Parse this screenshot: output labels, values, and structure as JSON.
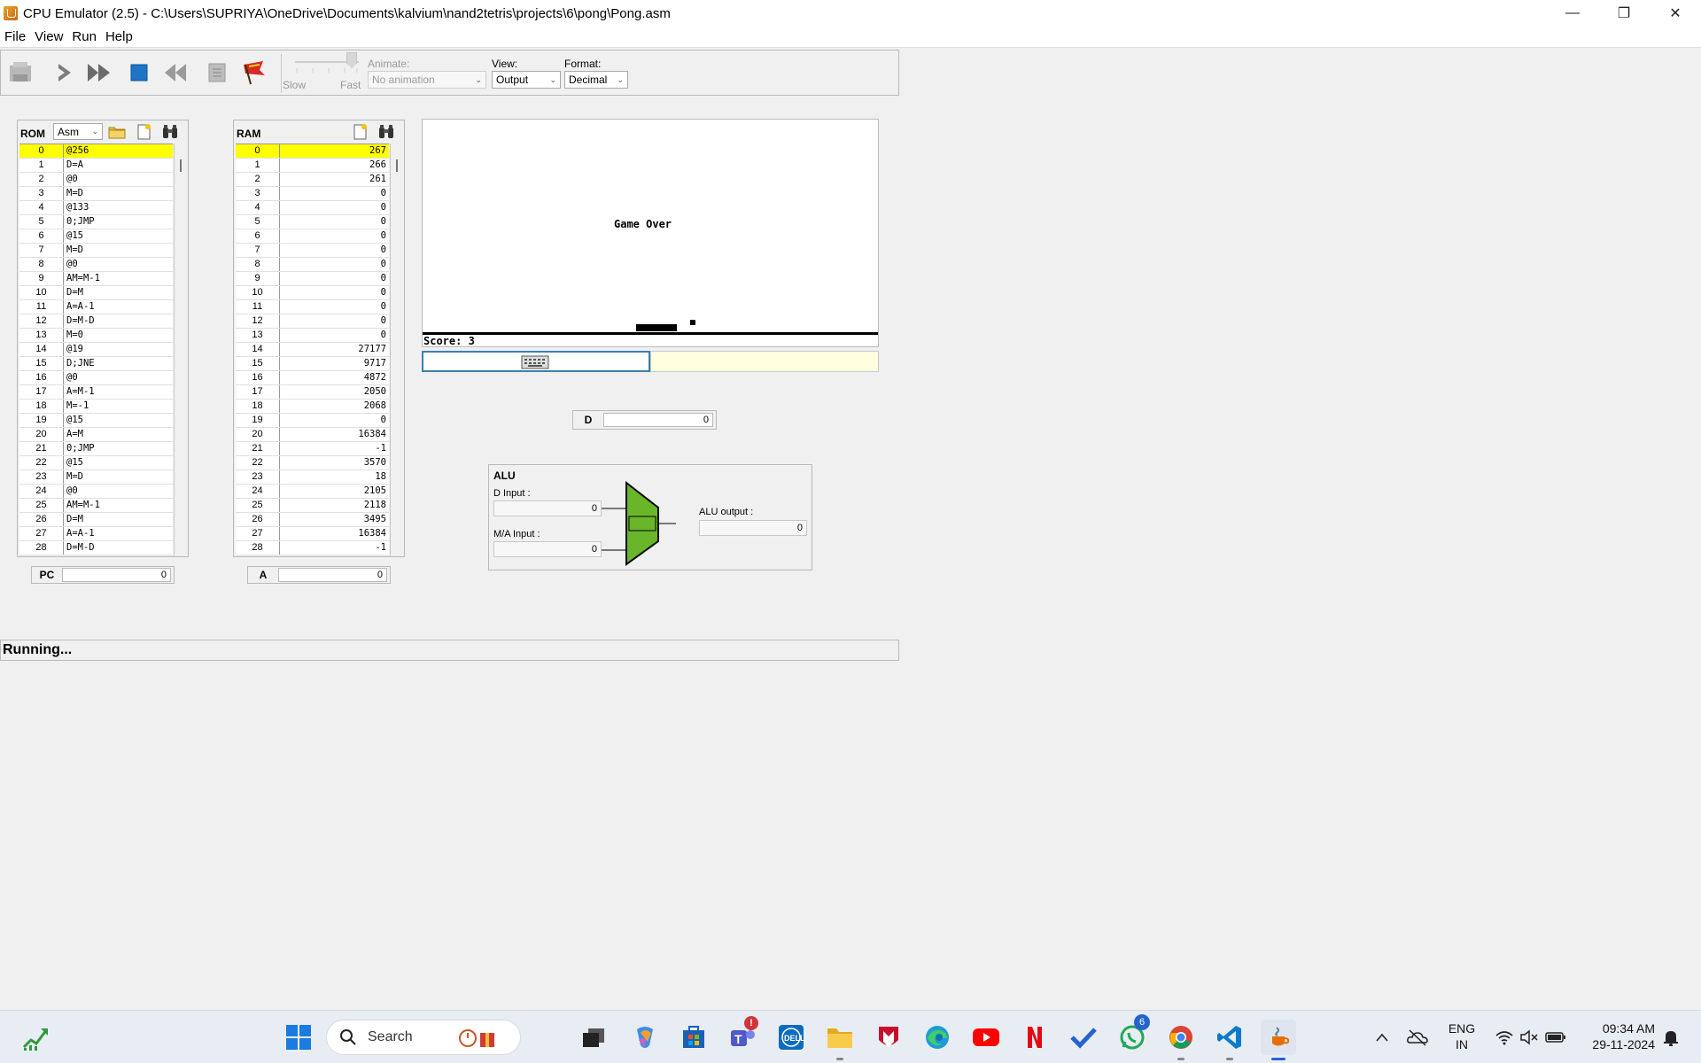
{
  "window": {
    "title": "CPU Emulator (2.5) - C:\\Users\\SUPRIYA\\OneDrive\\Documents\\kalvium\\nand2tetris\\projects\\6\\pong\\Pong.asm",
    "minimize": "—",
    "maximize": "❐",
    "close": "✕"
  },
  "menu": [
    "File",
    "View",
    "Run",
    "Help"
  ],
  "toolbar": {
    "slow_label": "Slow",
    "fast_label": "Fast",
    "animate_label": "Animate:",
    "animate_value": "No animation",
    "view_label": "View:",
    "view_value": "Output",
    "format_label": "Format:",
    "format_value": "Decimal"
  },
  "rom": {
    "title": "ROM",
    "mode": "Asm",
    "rows": [
      [
        "0",
        "@256"
      ],
      [
        "1",
        "D=A"
      ],
      [
        "2",
        "@0"
      ],
      [
        "3",
        "M=D"
      ],
      [
        "4",
        "@133"
      ],
      [
        "5",
        "0;JMP"
      ],
      [
        "6",
        "@15"
      ],
      [
        "7",
        "M=D"
      ],
      [
        "8",
        "@0"
      ],
      [
        "9",
        "AM=M-1"
      ],
      [
        "10",
        "D=M"
      ],
      [
        "11",
        "A=A-1"
      ],
      [
        "12",
        "D=M-D"
      ],
      [
        "13",
        "M=0"
      ],
      [
        "14",
        "@19"
      ],
      [
        "15",
        "D;JNE"
      ],
      [
        "16",
        "@0"
      ],
      [
        "17",
        "A=M-1"
      ],
      [
        "18",
        "M=-1"
      ],
      [
        "19",
        "@15"
      ],
      [
        "20",
        "A=M"
      ],
      [
        "21",
        "0;JMP"
      ],
      [
        "22",
        "@15"
      ],
      [
        "23",
        "M=D"
      ],
      [
        "24",
        "@0"
      ],
      [
        "25",
        "AM=M-1"
      ],
      [
        "26",
        "D=M"
      ],
      [
        "27",
        "A=A-1"
      ],
      [
        "28",
        "D=M-D"
      ]
    ]
  },
  "ram": {
    "title": "RAM",
    "rows": [
      [
        "0",
        "267"
      ],
      [
        "1",
        "266"
      ],
      [
        "2",
        "261"
      ],
      [
        "3",
        "0"
      ],
      [
        "4",
        "0"
      ],
      [
        "5",
        "0"
      ],
      [
        "6",
        "0"
      ],
      [
        "7",
        "0"
      ],
      [
        "8",
        "0"
      ],
      [
        "9",
        "0"
      ],
      [
        "10",
        "0"
      ],
      [
        "11",
        "0"
      ],
      [
        "12",
        "0"
      ],
      [
        "13",
        "0"
      ],
      [
        "14",
        "27177"
      ],
      [
        "15",
        "9717"
      ],
      [
        "16",
        "4872"
      ],
      [
        "17",
        "2050"
      ],
      [
        "18",
        "2068"
      ],
      [
        "19",
        "0"
      ],
      [
        "20",
        "16384"
      ],
      [
        "21",
        "-1"
      ],
      [
        "22",
        "3570"
      ],
      [
        "23",
        "18"
      ],
      [
        "24",
        "2105"
      ],
      [
        "25",
        "2118"
      ],
      [
        "26",
        "3495"
      ],
      [
        "27",
        "16384"
      ],
      [
        "28",
        "-1"
      ]
    ]
  },
  "registers": {
    "pc_label": "PC",
    "pc_value": "0",
    "a_label": "A",
    "a_value": "0",
    "d_label": "D",
    "d_value": "0"
  },
  "screen": {
    "message": "Game Over",
    "score": "Score: 3"
  },
  "alu": {
    "title": "ALU",
    "d_input_label": "D Input :",
    "d_input_value": "0",
    "ma_input_label": "M/A Input :",
    "ma_input_value": "0",
    "output_label": "ALU output :",
    "output_value": "0",
    "color": "#6ab62a"
  },
  "status": "Running...",
  "taskbar": {
    "search_placeholder": "Search",
    "teams_badge": "!",
    "whatsapp_badge": "6",
    "lang_line1": "ENG",
    "lang_line2": "IN",
    "time": "09:34 AM",
    "date": "29-11-2024"
  }
}
